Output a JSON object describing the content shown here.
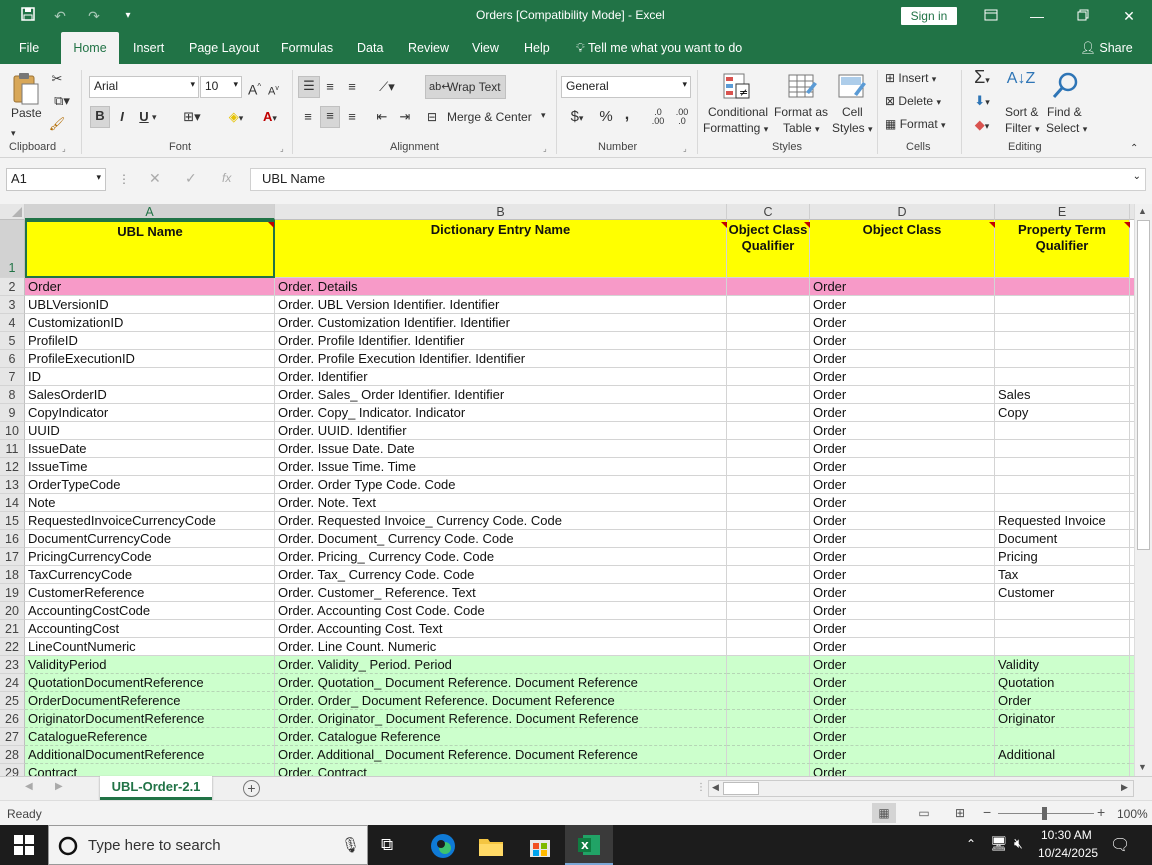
{
  "titlebar": {
    "title": "Orders  [Compatibility Mode]  -  Excel",
    "signin_label": "Sign in",
    "qat_icons": [
      "save-icon",
      "undo-icon",
      "redo-icon",
      "customize-qat-icon"
    ],
    "window_buttons": [
      "ribbon-display-icon",
      "minimize-icon",
      "restore-icon",
      "close-icon"
    ]
  },
  "tabs": [
    {
      "label": "File"
    },
    {
      "label": "Home"
    },
    {
      "label": "Insert"
    },
    {
      "label": "Page Layout"
    },
    {
      "label": "Formulas"
    },
    {
      "label": "Data"
    },
    {
      "label": "Review"
    },
    {
      "label": "View"
    },
    {
      "label": "Help"
    }
  ],
  "tell_me": "Tell me what you want to do",
  "share_label": "Share",
  "ribbon": {
    "clipboard": {
      "paste": "Paste",
      "group": "Clipboard"
    },
    "font": {
      "name": "Arial",
      "size": "10",
      "bold": "B",
      "italic": "I",
      "underline": "U",
      "group": "Font",
      "grow": "A",
      "shrink": "A"
    },
    "alignment": {
      "wrap": "Wrap Text",
      "merge": "Merge & Center",
      "group": "Alignment"
    },
    "number": {
      "format": "General",
      "currency": "$",
      "percent": "%",
      "comma": ",",
      "inc": "←.0 .00",
      "dec": ".00 →.0",
      "group": "Number"
    },
    "styles": {
      "cond1": "Conditional",
      "cond2": "Formatting",
      "fmt1": "Format as",
      "fmt2": "Table",
      "cell1": "Cell",
      "cell2": "Styles",
      "group": "Styles"
    },
    "cells": {
      "insert": "Insert",
      "delete": "Delete",
      "format": "Format",
      "group": "Cells"
    },
    "editing": {
      "sort1": "Sort &",
      "sort2": "Filter",
      "find1": "Find &",
      "find2": "Select",
      "group": "Editing"
    }
  },
  "formula_bar": {
    "namebox": "A1",
    "fx": "fx",
    "content": "UBL Name"
  },
  "colors": {
    "excel_green": "#217346",
    "header_yellow": "#ffff00",
    "row_pink": "#f79ac8",
    "row_green": "#ccffcc"
  },
  "columns": [
    {
      "letter": "A"
    },
    {
      "letter": "B"
    },
    {
      "letter": "C"
    },
    {
      "letter": "D"
    },
    {
      "letter": "E"
    }
  ],
  "header_row": {
    "num": "1",
    "a": "UBL Name",
    "b": "Dictionary Entry Name",
    "c": "Object Class Qualifier",
    "d": "Object Class",
    "e": "Property Term Qualifier"
  },
  "rows": [
    {
      "n": "2",
      "a": "Order",
      "b": "Order. Details",
      "c": "",
      "d": "Order",
      "e": "",
      "bg": "pink"
    },
    {
      "n": "3",
      "a": "UBLVersionID",
      "b": "Order. UBL Version Identifier. Identifier",
      "c": "",
      "d": "Order",
      "e": "",
      "bg": ""
    },
    {
      "n": "4",
      "a": "CustomizationID",
      "b": "Order. Customization Identifier. Identifier",
      "c": "",
      "d": "Order",
      "e": "",
      "bg": ""
    },
    {
      "n": "5",
      "a": "ProfileID",
      "b": "Order. Profile Identifier. Identifier",
      "c": "",
      "d": "Order",
      "e": "",
      "bg": ""
    },
    {
      "n": "6",
      "a": "ProfileExecutionID",
      "b": "Order. Profile Execution Identifier. Identifier",
      "c": "",
      "d": "Order",
      "e": "",
      "bg": ""
    },
    {
      "n": "7",
      "a": "ID",
      "b": "Order. Identifier",
      "c": "",
      "d": "Order",
      "e": "",
      "bg": ""
    },
    {
      "n": "8",
      "a": "SalesOrderID",
      "b": "Order. Sales_ Order Identifier. Identifier",
      "c": "",
      "d": "Order",
      "e": "Sales",
      "bg": ""
    },
    {
      "n": "9",
      "a": "CopyIndicator",
      "b": "Order. Copy_ Indicator. Indicator",
      "c": "",
      "d": "Order",
      "e": "Copy",
      "bg": ""
    },
    {
      "n": "10",
      "a": "UUID",
      "b": "Order. UUID. Identifier",
      "c": "",
      "d": "Order",
      "e": "",
      "bg": ""
    },
    {
      "n": "11",
      "a": "IssueDate",
      "b": "Order. Issue Date. Date",
      "c": "",
      "d": "Order",
      "e": "",
      "bg": ""
    },
    {
      "n": "12",
      "a": "IssueTime",
      "b": "Order. Issue Time. Time",
      "c": "",
      "d": "Order",
      "e": "",
      "bg": ""
    },
    {
      "n": "13",
      "a": "OrderTypeCode",
      "b": "Order. Order Type Code. Code",
      "c": "",
      "d": "Order",
      "e": "",
      "bg": ""
    },
    {
      "n": "14",
      "a": "Note",
      "b": "Order. Note. Text",
      "c": "",
      "d": "Order",
      "e": "",
      "bg": ""
    },
    {
      "n": "15",
      "a": "RequestedInvoiceCurrencyCode",
      "b": "Order. Requested Invoice_ Currency Code. Code",
      "c": "",
      "d": "Order",
      "e": "Requested Invoice",
      "bg": ""
    },
    {
      "n": "16",
      "a": "DocumentCurrencyCode",
      "b": "Order. Document_ Currency Code. Code",
      "c": "",
      "d": "Order",
      "e": "Document",
      "bg": ""
    },
    {
      "n": "17",
      "a": "PricingCurrencyCode",
      "b": "Order. Pricing_ Currency Code. Code",
      "c": "",
      "d": "Order",
      "e": "Pricing",
      "bg": ""
    },
    {
      "n": "18",
      "a": "TaxCurrencyCode",
      "b": "Order. Tax_ Currency Code. Code",
      "c": "",
      "d": "Order",
      "e": "Tax",
      "bg": ""
    },
    {
      "n": "19",
      "a": "CustomerReference",
      "b": "Order. Customer_ Reference. Text",
      "c": "",
      "d": "Order",
      "e": "Customer",
      "bg": ""
    },
    {
      "n": "20",
      "a": "AccountingCostCode",
      "b": "Order. Accounting Cost Code. Code",
      "c": "",
      "d": "Order",
      "e": "",
      "bg": ""
    },
    {
      "n": "21",
      "a": "AccountingCost",
      "b": "Order. Accounting Cost. Text",
      "c": "",
      "d": "Order",
      "e": "",
      "bg": ""
    },
    {
      "n": "22",
      "a": "LineCountNumeric",
      "b": "Order. Line Count. Numeric",
      "c": "",
      "d": "Order",
      "e": "",
      "bg": ""
    },
    {
      "n": "23",
      "a": "ValidityPeriod",
      "b": "Order. Validity_ Period. Period",
      "c": "",
      "d": "Order",
      "e": "Validity",
      "bg": "green"
    },
    {
      "n": "24",
      "a": "QuotationDocumentReference",
      "b": "Order. Quotation_ Document Reference. Document Reference",
      "c": "",
      "d": "Order",
      "e": "Quotation",
      "bg": "green"
    },
    {
      "n": "25",
      "a": "OrderDocumentReference",
      "b": "Order. Order_ Document Reference. Document Reference",
      "c": "",
      "d": "Order",
      "e": "Order",
      "bg": "green"
    },
    {
      "n": "26",
      "a": "OriginatorDocumentReference",
      "b": "Order. Originator_ Document Reference. Document Reference",
      "c": "",
      "d": "Order",
      "e": "Originator",
      "bg": "green"
    },
    {
      "n": "27",
      "a": "CatalogueReference",
      "b": "Order. Catalogue Reference",
      "c": "",
      "d": "Order",
      "e": "",
      "bg": "green"
    },
    {
      "n": "28",
      "a": "AdditionalDocumentReference",
      "b": "Order. Additional_ Document Reference. Document Reference",
      "c": "",
      "d": "Order",
      "e": "Additional",
      "bg": "green"
    },
    {
      "n": "29",
      "a": "Contract",
      "b": "Order. Contract",
      "c": "",
      "d": "Order",
      "e": "",
      "bg": "green"
    }
  ],
  "sheet_tab": "UBL-Order-2.1",
  "status": {
    "ready": "Ready",
    "zoom": "100%"
  },
  "taskbar": {
    "search_placeholder": "Type here to search",
    "time": "10:30 AM",
    "date": "10/24/2025"
  }
}
